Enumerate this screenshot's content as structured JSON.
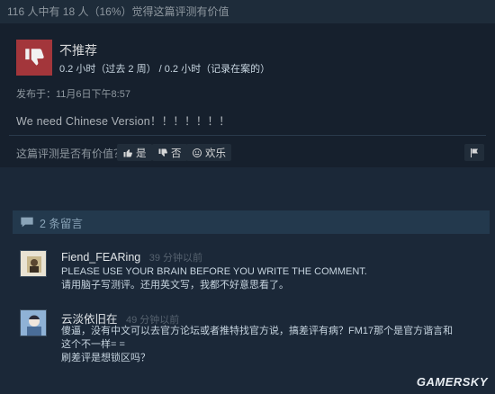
{
  "review": {
    "helpful_summary": "116 人中有 18 人（16%）觉得这篇评测有价值",
    "verdict": "不推荐",
    "hours": "0.2 小时（过去 2 周） / 0.2 小时（记录在案的）",
    "posted": "发布于：11月6日下午8:57",
    "content": "We need Chinese Version！！！！！！！",
    "vote_question": "这篇评测是否有价值？",
    "yes_label": "是",
    "no_label": "否",
    "funny_label": "欢乐",
    "verdict_color": "#a3363b"
  },
  "comments": {
    "header": "2 条留言",
    "items": [
      {
        "author": "Fiend_FEARing",
        "time": "39 分钟以前",
        "lines": [
          "PLEASE USE YOUR BRAIN BEFORE YOU WRITE THE COMMENT.",
          "请用脑子写测评。还用英文写，我都不好意思看了。"
        ]
      },
      {
        "author": "云淡依旧在",
        "time": "49 分钟以前",
        "lines": [
          "傻逼，没有中文可以去官方论坛或者推特找官方说，搞差评有病？FM17那个是官方谐言和",
          "这个不一样= =",
          "刷差评是想锁区吗？"
        ]
      }
    ]
  },
  "watermark": "GAMERSKY"
}
